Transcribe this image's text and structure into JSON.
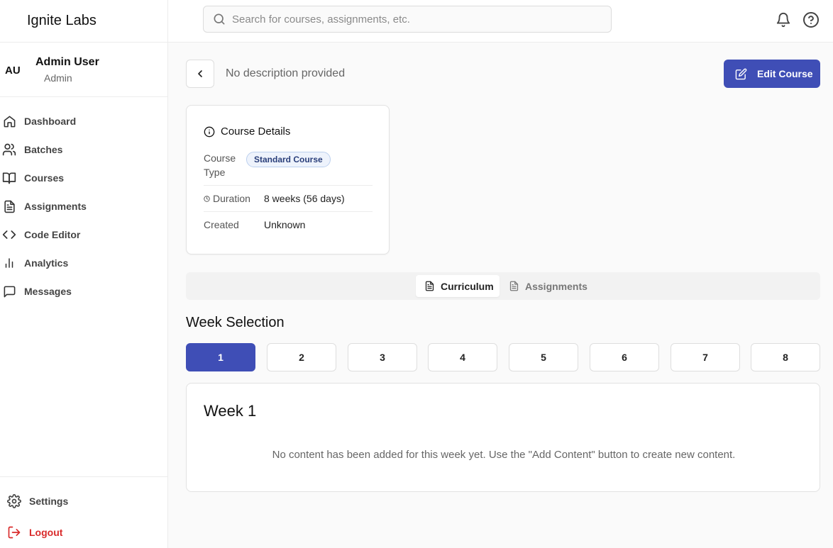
{
  "app": {
    "name": "Ignite Labs"
  },
  "user": {
    "initials": "AU",
    "name": "Admin User",
    "role": "Admin"
  },
  "nav": {
    "items": [
      {
        "label": "Dashboard",
        "icon": "home-icon"
      },
      {
        "label": "Batches",
        "icon": "users-icon"
      },
      {
        "label": "Courses",
        "icon": "book-icon"
      },
      {
        "label": "Assignments",
        "icon": "file-text-icon"
      },
      {
        "label": "Code Editor",
        "icon": "code-icon"
      },
      {
        "label": "Analytics",
        "icon": "bar-chart-icon"
      },
      {
        "label": "Messages",
        "icon": "message-square-icon"
      }
    ],
    "settings_label": "Settings",
    "logout_label": "Logout"
  },
  "search": {
    "placeholder": "Search for courses, assignments, etc."
  },
  "header": {
    "description": "No description provided",
    "edit_label": "Edit Course"
  },
  "details": {
    "title": "Course Details",
    "type_label": "Course\nType",
    "type_label_line1": "Course",
    "type_label_line2": "Type",
    "type_value": "Standard Course",
    "duration_label": "Duration",
    "duration_value": "8 weeks (56 days)",
    "created_label": "Created",
    "created_value": "Unknown"
  },
  "tabs": [
    {
      "label": "Curriculum",
      "active": true
    },
    {
      "label": "Assignments",
      "active": false
    }
  ],
  "weeks": {
    "heading": "Week Selection",
    "items": [
      "1",
      "2",
      "3",
      "4",
      "5",
      "6",
      "7",
      "8"
    ],
    "selected": "1"
  },
  "week_card": {
    "title": "Week 1",
    "empty_message": "No content has been added for this week yet. Use the \"Add Content\" button to create new content."
  },
  "colors": {
    "accent": "#3f4eb6",
    "logout": "#d92b2b"
  }
}
